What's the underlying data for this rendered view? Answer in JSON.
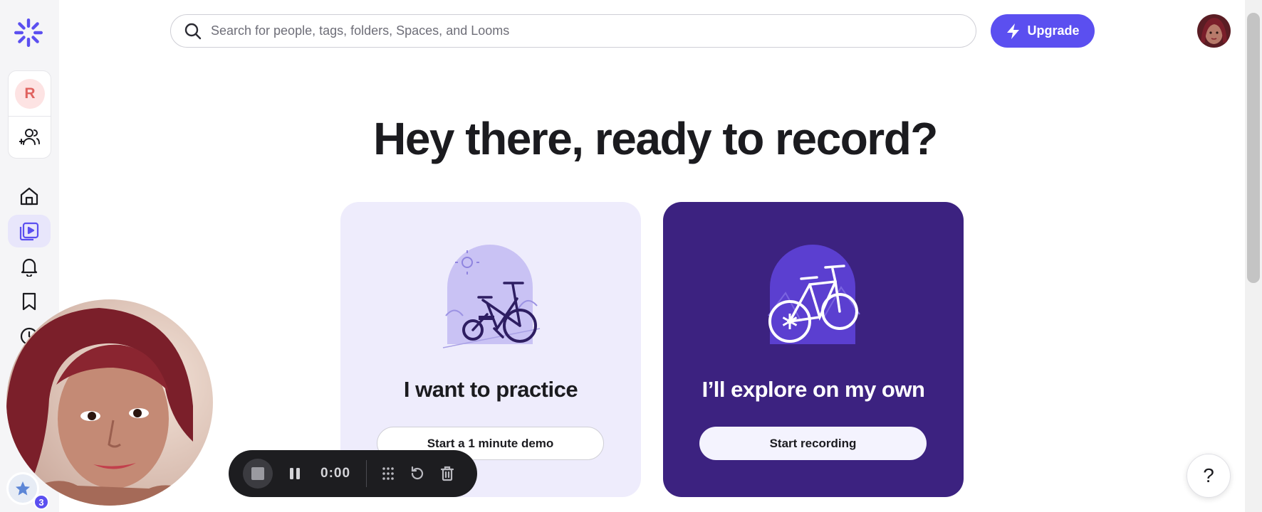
{
  "workspace": {
    "initial": "R"
  },
  "search": {
    "placeholder": "Search for people, tags, folders, Spaces, and Looms"
  },
  "header": {
    "upgrade_label": "Upgrade"
  },
  "hero": {
    "title": "Hey there, ready to record?"
  },
  "cards": [
    {
      "title": "I want to practice",
      "button": "Start a 1 minute demo"
    },
    {
      "title": "I’ll explore on my own",
      "button": "Start recording"
    }
  ],
  "recorder": {
    "time": "0:00"
  },
  "notifications": {
    "badge_count": "3"
  },
  "help": {
    "label": "?"
  },
  "colors": {
    "accent": "#5b4ff0",
    "dark_card": "#3c2280",
    "light_card": "#eeecfc"
  }
}
